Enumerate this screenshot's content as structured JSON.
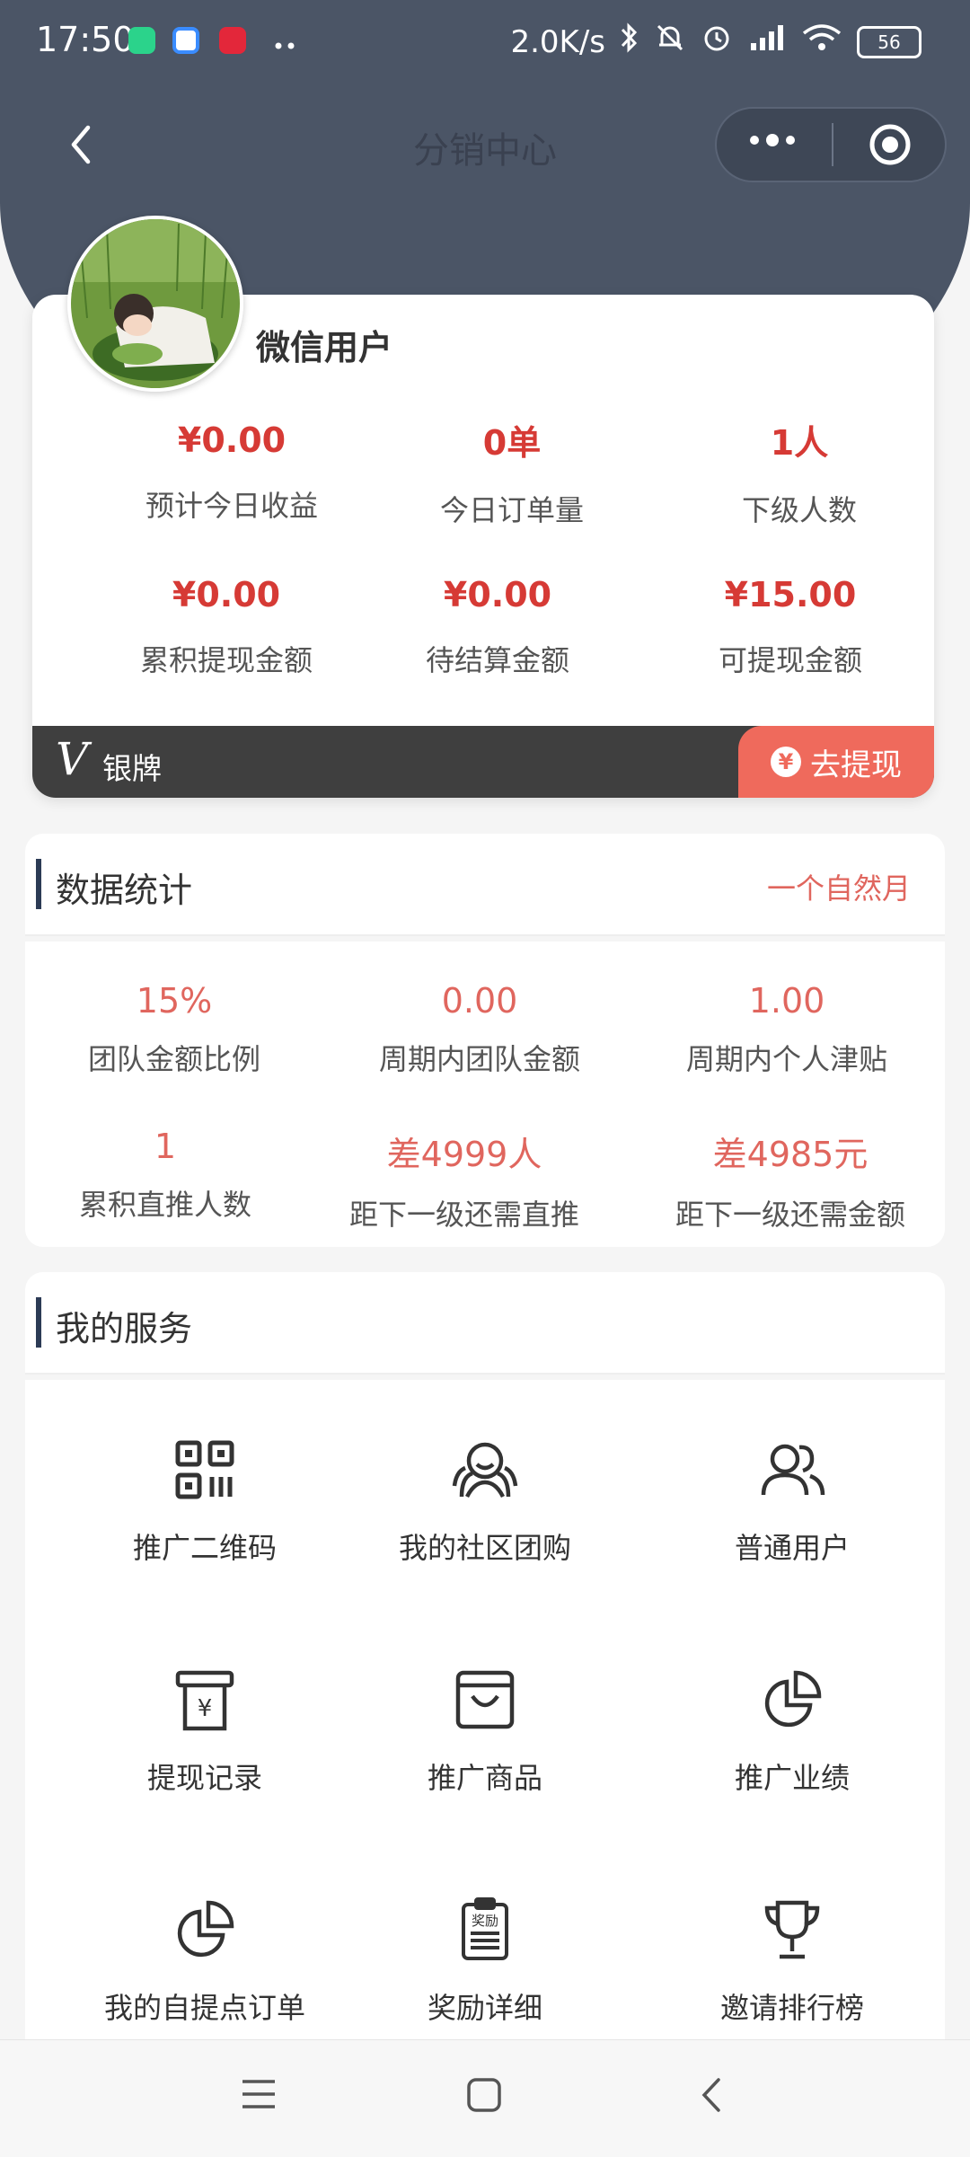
{
  "status_bar": {
    "time": "17:50",
    "network_speed": "2.0K/s",
    "battery": "56",
    "accent_icons": [
      "#2bd38b",
      "#3a8cff",
      "#e3273a"
    ]
  },
  "nav": {
    "title": "分销中心"
  },
  "profile": {
    "username": "微信用户",
    "stats": [
      {
        "value": "¥0.00",
        "label": "预计今日收益"
      },
      {
        "value": "0单",
        "label": "今日订单量"
      },
      {
        "value": "1人",
        "label": "下级人数"
      },
      {
        "value": "¥0.00",
        "label": "累积提现金额"
      },
      {
        "value": "¥0.00",
        "label": "待结算金额"
      },
      {
        "value": "¥15.00",
        "label": "可提现金额"
      }
    ],
    "level_mark": "V",
    "level_label": "银牌",
    "withdraw_label": "去提现",
    "withdraw_icon_glyph": "¥"
  },
  "data_stats": {
    "title": "数据统计",
    "period": "一个自然月",
    "metrics": [
      {
        "value": "15%",
        "label": "团队金额比例"
      },
      {
        "value": "0.00",
        "label": "周期内团队金额"
      },
      {
        "value": "1.00",
        "label": "周期内个人津贴"
      },
      {
        "value": "1",
        "label": "累积直推人数"
      },
      {
        "value": "差4999人",
        "label": "距下一级还需直推"
      },
      {
        "value": "差4985元",
        "label": "距下一级还需金额"
      }
    ]
  },
  "services": {
    "title": "我的服务",
    "items": [
      {
        "label": "推广二维码",
        "icon": "qr-code-icon"
      },
      {
        "label": "我的社区团购",
        "icon": "community-group-icon"
      },
      {
        "label": "普通用户",
        "icon": "users-icon"
      },
      {
        "label": "提现记录",
        "icon": "withdraw-record-icon"
      },
      {
        "label": "推广商品",
        "icon": "shopping-bag-icon"
      },
      {
        "label": "推广业绩",
        "icon": "pie-chart-icon"
      },
      {
        "label": "我的自提点订单",
        "icon": "pie-chart-icon"
      },
      {
        "label": "奖励详细",
        "icon": "reward-clipboard-icon"
      },
      {
        "label": "邀请排行榜",
        "icon": "trophy-icon"
      }
    ],
    "reward_icon_text": "奖励"
  },
  "colors": {
    "header": "#4b5566",
    "accent_red": "#d63a35",
    "soft_red": "#e0665e",
    "withdraw_button": "#ef6a5c"
  }
}
